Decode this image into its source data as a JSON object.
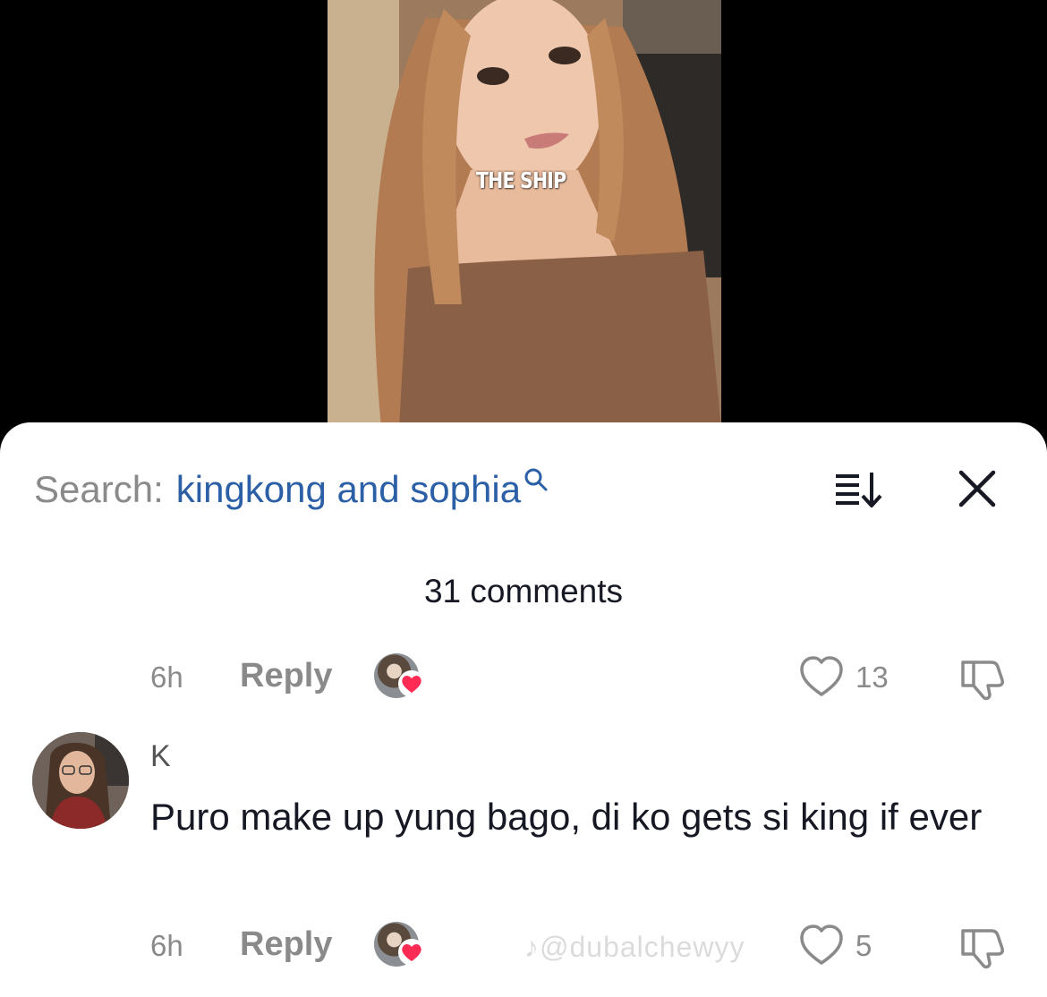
{
  "video": {
    "caption": "THE SHIP"
  },
  "search": {
    "label": "Search:",
    "query": "kingkong and sophia"
  },
  "comments_header": {
    "count_text": "31 comments"
  },
  "previous_comment_actions": {
    "time": "6h",
    "reply_label": "Reply",
    "like_count": "13"
  },
  "comment": {
    "username": "K",
    "text": "Puro make up yung bago, di ko gets si king if ever",
    "time": "6h",
    "reply_label": "Reply",
    "like_count": "5"
  },
  "watermark": {
    "text": "@dubalchewyy"
  },
  "colors": {
    "accent_link": "#2b5fa6",
    "muted_text": "#8a8a8a",
    "heart_badge": "#fe2c55"
  },
  "icons": [
    "search-icon",
    "sort-icon",
    "close-icon",
    "heart-outline-icon",
    "dislike-icon",
    "tiktok-logo-icon"
  ]
}
